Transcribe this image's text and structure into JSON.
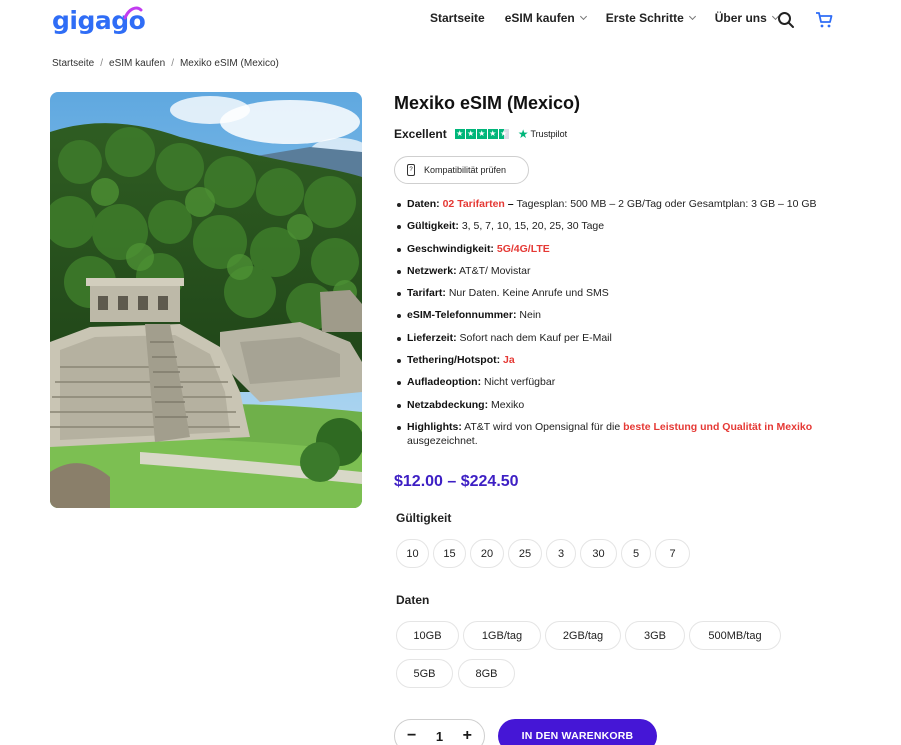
{
  "header": {
    "logo_text_a": "giga",
    "logo_text_b": "go",
    "nav": [
      {
        "label": "Startseite",
        "has_dropdown": false
      },
      {
        "label": "eSIM kaufen",
        "has_dropdown": true
      },
      {
        "label": "Erste Schritte",
        "has_dropdown": true
      },
      {
        "label": "Über uns",
        "has_dropdown": true
      }
    ],
    "search_icon": "search-icon",
    "cart_icon": "cart-icon"
  },
  "breadcrumb": [
    "Startseite",
    "eSIM kaufen",
    "Mexiko eSIM (Mexico)"
  ],
  "product": {
    "title": "Mexiko eSIM (Mexico)",
    "rating_text": "Excellent",
    "trustpilot": "Trustpilot",
    "stars": 4.5,
    "compat_button": "Kompatibilität prüfen",
    "features": [
      {
        "key": "Daten:",
        "red": "02 Tarifarten",
        "sep": " – ",
        "value": "Tagesplan: 500 MB – 2 GB/Tag oder Gesamtplan: 3 GB – 10 GB"
      },
      {
        "key": "Gültigkeit:",
        "value": " 3, 5, 7, 10, 15, 20, 25, 30 Tage"
      },
      {
        "key": "Geschwindigkeit:",
        "red": " 5G/4G/LTE"
      },
      {
        "key": "Netzwerk:",
        "value": " AT&T/ Movistar"
      },
      {
        "key": "Tarifart:",
        "value": " Nur Daten. Keine Anrufe und SMS"
      },
      {
        "key": "eSIM-Telefonnummer:",
        "value": " Nein"
      },
      {
        "key": "Lieferzeit:",
        "value": " Sofort nach dem Kauf per E-Mail"
      },
      {
        "key": "Tethering/Hotspot:",
        "red": " Ja"
      },
      {
        "key": "Aufladeoption:",
        "value": " Nicht verfügbar"
      },
      {
        "key": "Netzabdeckung:",
        "value": " Mexiko"
      },
      {
        "key": "Highlights:",
        "value": " AT&T wird von Opensignal für die ",
        "red": "beste Leistung und Qualität in Mexiko",
        "value2": " ausgezeichnet."
      }
    ],
    "price": "$12.00 – $224.50",
    "validity_label": "Gültigkeit",
    "validity_options": [
      "10",
      "15",
      "20",
      "25",
      "3",
      "30",
      "5",
      "7"
    ],
    "data_label": "Daten",
    "data_options": [
      "10GB",
      "1GB/tag",
      "2GB/tag",
      "3GB",
      "500MB/tag",
      "5GB",
      "8GB"
    ],
    "quantity": "1",
    "qty_minus": "−",
    "qty_plus": "+",
    "add_to_cart": "IN DEN WARENKORB"
  },
  "colors": {
    "brand_blue": "#2f6df6",
    "price_purple": "#3d1fc4",
    "button_purple": "#4516d6",
    "highlight_red": "#e53935",
    "trustpilot_green": "#00b67a"
  }
}
